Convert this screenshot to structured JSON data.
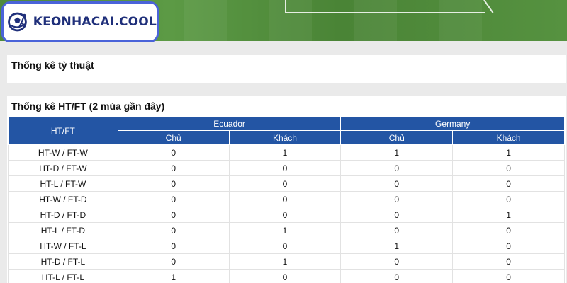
{
  "logo": {
    "text": "KEONHACAI.COOL"
  },
  "section1": {
    "title": "Thống kê tỷ thuật"
  },
  "section2": {
    "title": "Thống kê HT/FT (2 mùa gần đây)",
    "table": {
      "col_header": "HT/FT",
      "teams": [
        "Ecuador",
        "Germany"
      ],
      "sub_headers": [
        "Chủ",
        "Khách",
        "Chủ",
        "Khách"
      ],
      "rows": [
        {
          "label": "HT-W / FT-W",
          "values": [
            "0",
            "1",
            "1",
            "1"
          ]
        },
        {
          "label": "HT-D / FT-W",
          "values": [
            "0",
            "0",
            "0",
            "0"
          ]
        },
        {
          "label": "HT-L / FT-W",
          "values": [
            "0",
            "0",
            "0",
            "0"
          ]
        },
        {
          "label": "HT-W / FT-D",
          "values": [
            "0",
            "0",
            "0",
            "0"
          ]
        },
        {
          "label": "HT-D / FT-D",
          "values": [
            "0",
            "0",
            "0",
            "1"
          ]
        },
        {
          "label": "HT-L / FT-D",
          "values": [
            "0",
            "1",
            "0",
            "0"
          ]
        },
        {
          "label": "HT-W / FT-L",
          "values": [
            "0",
            "0",
            "1",
            "0"
          ]
        },
        {
          "label": "HT-D / FT-L",
          "values": [
            "0",
            "1",
            "0",
            "0"
          ]
        },
        {
          "label": "HT-L / FT-L",
          "values": [
            "1",
            "0",
            "0",
            "0"
          ]
        }
      ]
    }
  },
  "colors": {
    "header_blue": "#2355a4",
    "logo_border": "#4a63d9",
    "logo_text": "#1f2f7a",
    "pitch_green": "#5c9a45"
  }
}
